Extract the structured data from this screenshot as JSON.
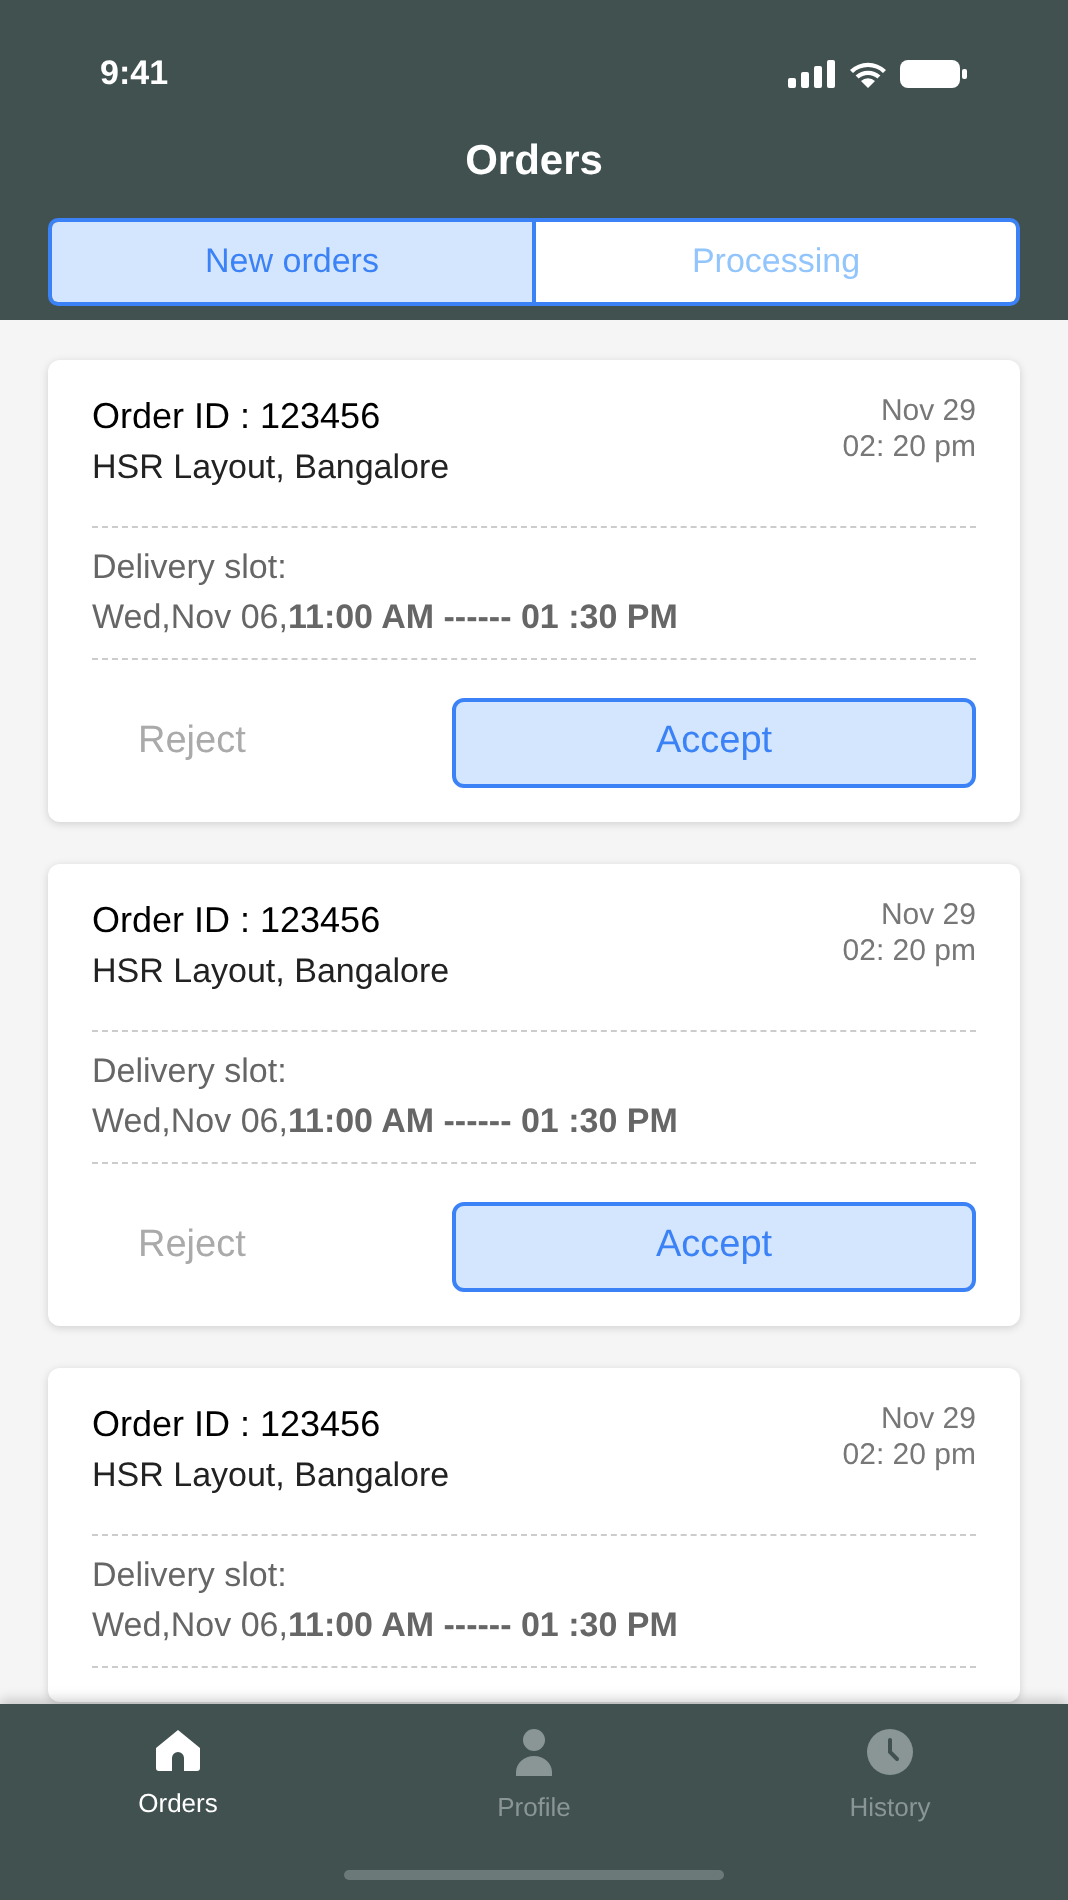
{
  "status_bar": {
    "time": "9:41"
  },
  "header": {
    "title": "Orders"
  },
  "tabs": [
    {
      "label": "New orders",
      "selected": true
    },
    {
      "label": "Processing",
      "selected": false
    }
  ],
  "orders": [
    {
      "order_id": "Order ID : 123456",
      "address": "HSR Layout, Bangalore",
      "date": "Nov 29",
      "time": "02: 20 pm",
      "slot_label": "Delivery slot:",
      "slot": "Wed,Nov 06,**11:00 AM ------ 01 :30 PM**",
      "buttons": [
        {
          "label": "Reject",
          "kind": "text"
        },
        {
          "label": "Accept",
          "kind": "primary"
        }
      ]
    },
    {
      "order_id": "Order ID : 123456",
      "address": "HSR Layout, Bangalore",
      "date": "Nov 29",
      "time": "02: 20 pm",
      "slot_label": "Delivery slot:",
      "slot": "Wed,Nov 06,**11:00 AM ------ 01 :30 PM**",
      "buttons": [
        {
          "label": "Reject",
          "kind": "text"
        },
        {
          "label": "Accept",
          "kind": "primary"
        }
      ]
    },
    {
      "order_id": "Order ID : 123456",
      "address": "HSR Layout, Bangalore",
      "date": "Nov 29",
      "time": "02: 20 pm",
      "slot_label": "Delivery slot:",
      "slot": "Wed,Nov 06,**11:00 AM ------ 01 :30 PM**"
    }
  ],
  "bottom_nav": [
    {
      "label": "Orders",
      "selected": true
    },
    {
      "label": "Profile",
      "selected": false
    },
    {
      "label": "History",
      "selected": false
    }
  ]
}
